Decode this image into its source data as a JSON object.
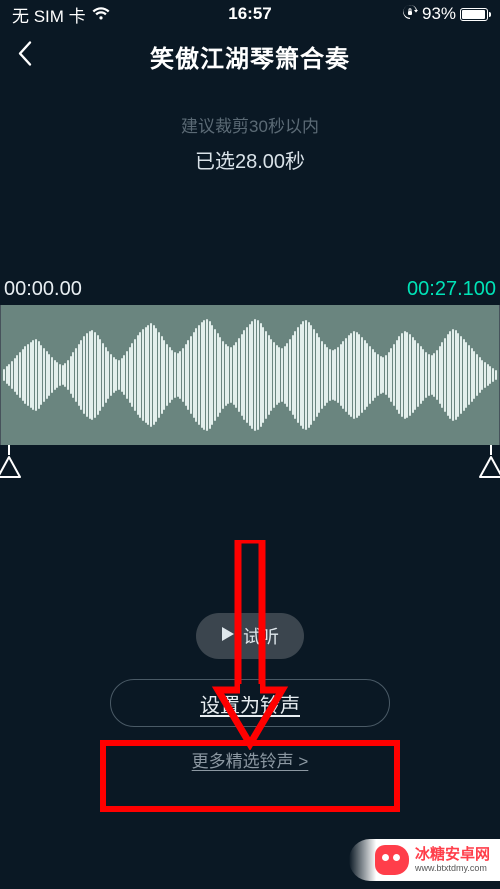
{
  "status": {
    "carrier": "无 SIM 卡",
    "time": "16:57",
    "battery_pct": "93%",
    "battery_fill_pct": 93
  },
  "header": {
    "title": "笑傲江湖琴箫合奏"
  },
  "trim": {
    "hint": "建议裁剪30秒以内",
    "selected": "已选28.00秒",
    "start_time": "00:00.00",
    "end_time": "00:27.100"
  },
  "buttons": {
    "preview_label": "试听",
    "set_ringtone_label": "设置为铃声",
    "more_link_label": "更多精选铃声 >"
  },
  "watermark": {
    "brand": "冰糖安卓网",
    "url": "www.btxtdmy.com"
  },
  "waveform": {
    "heights": [
      12,
      18,
      22,
      28,
      34,
      40,
      46,
      52,
      58,
      62,
      66,
      70,
      72,
      68,
      60,
      54,
      48,
      42,
      36,
      30,
      26,
      22,
      20,
      24,
      30,
      38,
      46,
      54,
      62,
      70,
      78,
      84,
      88,
      90,
      86,
      80,
      72,
      64,
      56,
      48,
      42,
      36,
      32,
      30,
      34,
      40,
      48,
      56,
      64,
      72,
      80,
      86,
      92,
      96,
      100,
      104,
      100,
      94,
      86,
      78,
      70,
      62,
      56,
      50,
      46,
      44,
      48,
      54,
      62,
      70,
      78,
      86,
      94,
      100,
      106,
      110,
      112,
      108,
      100,
      92,
      84,
      76,
      68,
      62,
      58,
      56,
      60,
      66,
      74,
      82,
      90,
      96,
      102,
      108,
      112,
      110,
      104,
      96,
      88,
      80,
      72,
      66,
      60,
      56,
      54,
      58,
      64,
      72,
      80,
      88,
      96,
      102,
      108,
      110,
      106,
      100,
      92,
      84,
      76,
      68,
      62,
      56,
      52,
      50,
      52,
      56,
      62,
      68,
      74,
      80,
      84,
      88,
      86,
      82,
      76,
      70,
      64,
      58,
      52,
      46,
      42,
      38,
      36,
      40,
      46,
      54,
      62,
      70,
      78,
      84,
      88,
      86,
      82,
      76,
      70,
      64,
      58,
      52,
      46,
      42,
      40,
      44,
      50,
      58,
      66,
      74,
      82,
      88,
      92,
      90,
      84,
      78,
      72,
      66,
      60,
      54,
      48,
      42,
      36,
      30,
      26,
      22,
      18,
      14,
      10
    ]
  }
}
